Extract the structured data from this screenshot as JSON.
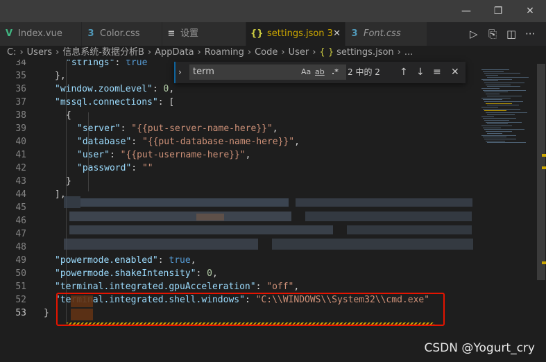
{
  "tabs": [
    {
      "icon": "vue-icon",
      "glyph": "V",
      "color": "#41b883",
      "label": "Index.vue"
    },
    {
      "icon": "css-icon",
      "glyph": "3",
      "color": "#519aba",
      "label": "Color.css"
    },
    {
      "icon": "file-icon",
      "glyph": "≡",
      "color": "#c5c5c5",
      "label": "设置"
    },
    {
      "icon": "json-icon",
      "glyph": "{}",
      "color": "#cbcb41",
      "label": "settings.json 3",
      "close": "✕"
    },
    {
      "icon": "css-icon",
      "glyph": "3",
      "color": "#519aba",
      "label": "Font.css"
    }
  ],
  "window": {
    "minimize": "—",
    "maximize": "❐",
    "close": "✕"
  },
  "tab_actions": {
    "run": "▷",
    "open_changes": "⎘",
    "split": "◫",
    "more": "···"
  },
  "breadcrumb": [
    "C:",
    "Users",
    "信息系统-数据分析B",
    "AppData",
    "Roaming",
    "Code",
    "User",
    "settings.json",
    "..."
  ],
  "find": {
    "query": "term",
    "match_case": "Aa",
    "whole_word": "ab",
    "regex": ".*",
    "count": "2 中的 2",
    "prev": "↑",
    "next": "↓",
    "selection": "≡",
    "close": "✕",
    "toggle": "›"
  },
  "code_lines": [
    {
      "n": "34",
      "t": "    \"strings\": true"
    },
    {
      "n": "35",
      "t": "  },"
    },
    {
      "n": "36",
      "t": "  \"window.zoomLevel\": 0,"
    },
    {
      "n": "37",
      "t": "  \"mssql.connections\": ["
    },
    {
      "n": "38",
      "t": "    {"
    },
    {
      "n": "39",
      "t": "      \"server\": \"{{put-server-name-here}}\","
    },
    {
      "n": "40",
      "t": "      \"database\": \"{{put-database-name-here}}\","
    },
    {
      "n": "41",
      "t": "      \"user\": \"{{put-username-here}}\","
    },
    {
      "n": "42",
      "t": "      \"password\": \"\""
    },
    {
      "n": "43",
      "t": "    }"
    },
    {
      "n": "44",
      "t": "  ],"
    },
    {
      "n": "45",
      "t": ""
    },
    {
      "n": "46",
      "t": ""
    },
    {
      "n": "47",
      "t": ""
    },
    {
      "n": "48",
      "t": ""
    },
    {
      "n": "49",
      "t": "  \"powermode.enabled\": true,"
    },
    {
      "n": "50",
      "t": "  \"powermode.shakeIntensity\": 0,"
    },
    {
      "n": "51",
      "t": "  \"terminal.integrated.gpuAcceleration\": \"off\","
    },
    {
      "n": "52",
      "t": "  \"terminal.integrated.shell.windows\": \"C:\\\\WINDOWS\\\\System32\\\\cmd.exe\""
    },
    {
      "n": "53",
      "t": "}"
    }
  ],
  "watermark": "CSDN @Yogurt_cry",
  "colors": {
    "key": "#9cdcfe",
    "string": "#ce9178",
    "number": "#b5cea8",
    "bool": "#569cd6",
    "highlight_box": "#e51400"
  }
}
